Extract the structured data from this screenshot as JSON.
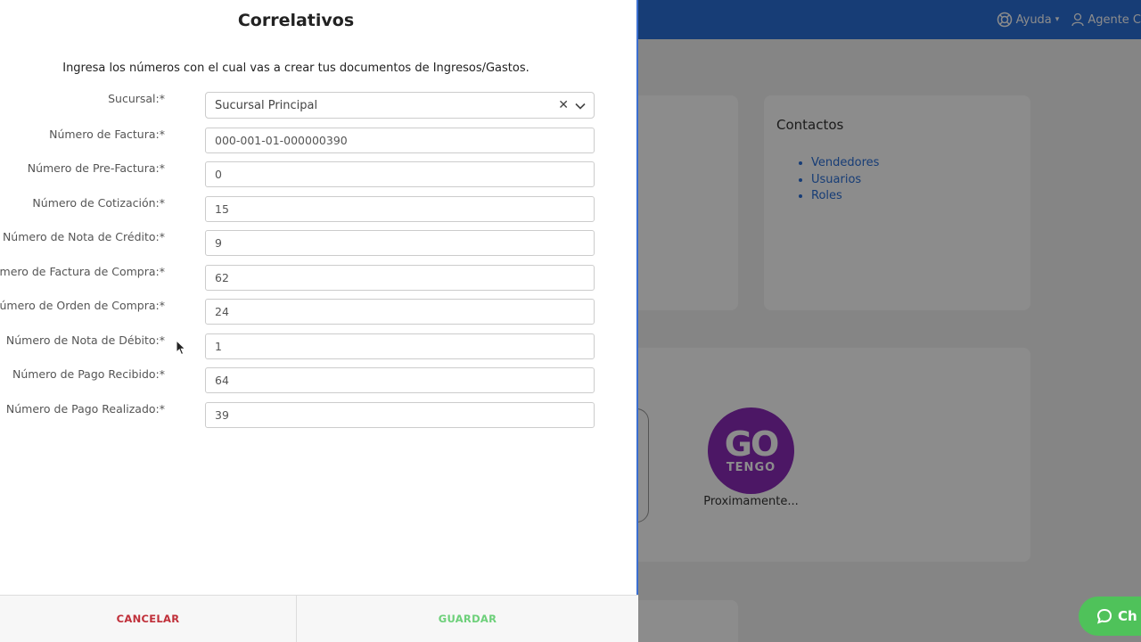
{
  "background": {
    "topbar": {
      "help_label": "Ayuda",
      "agent_label": "Agente C"
    },
    "contacts_card": {
      "title": "Contactos",
      "links": [
        "Vendedores",
        "Usuarios",
        "Roles"
      ]
    },
    "logo": {
      "text_main": "GO",
      "text_sub": "TENGO",
      "caption": "Proximamente..."
    },
    "chat_label": "Ch"
  },
  "modal": {
    "title": "Correlativos",
    "intro": "Ingresa los números con el cual vas a crear tus documentos de Ingresos/Gastos.",
    "branch": {
      "label": "Sucursal:*",
      "value": "Sucursal Principal"
    },
    "fields": [
      {
        "label": "Número de Factura:*",
        "value": "000-001-01-000000390"
      },
      {
        "label": "Número de Pre-Factura:*",
        "value": "0"
      },
      {
        "label": "Número de Cotización:*",
        "value": "15"
      },
      {
        "label": "Número de Nota de Crédito:*",
        "value": "9"
      },
      {
        "label": "Número de Factura de Compra:*",
        "value": "62"
      },
      {
        "label": "Número de Orden de Compra:*",
        "value": "24"
      },
      {
        "label": "Número de Nota de Débito:*",
        "value": "1"
      },
      {
        "label": "Número de Pago Recibido:*",
        "value": "64"
      },
      {
        "label": "Número de Pago Realizado:*",
        "value": "39"
      }
    ],
    "cancel_label": "CANCELAR",
    "save_label": "GUARDAR"
  },
  "colors": {
    "topbar": "#2a6fd8",
    "link": "#2a6fd8",
    "cancel": "#c0303a",
    "save": "#6dd07a",
    "chat": "#4fc25a",
    "logo": "#8a2bb8"
  }
}
